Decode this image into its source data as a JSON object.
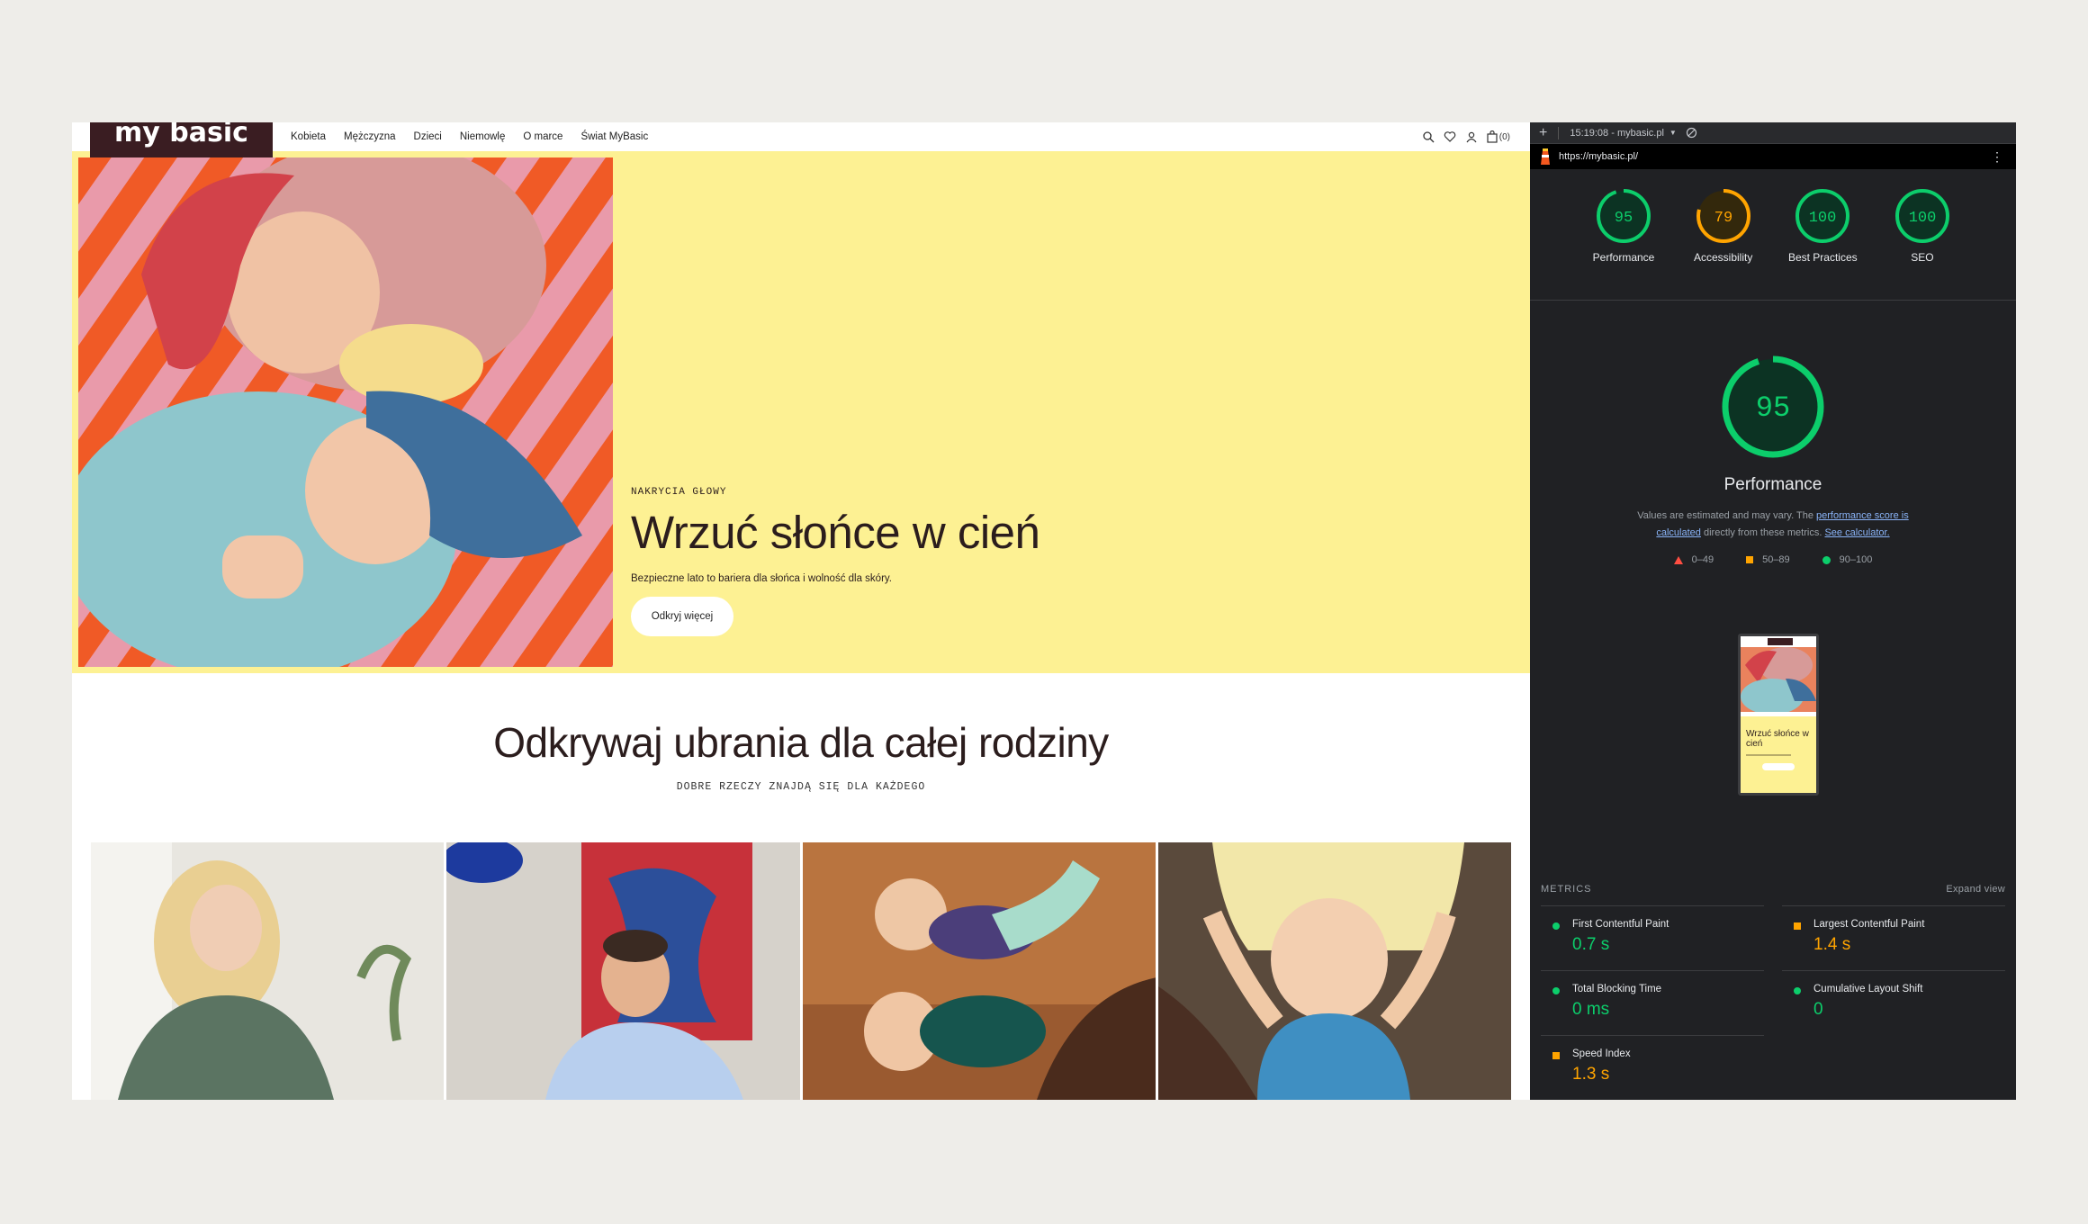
{
  "site": {
    "logo": "my basic",
    "nav": [
      "Kobieta",
      "Mężczyzna",
      "Dzieci",
      "Niemowlę",
      "O marce",
      "Świat MyBasic"
    ],
    "cart_count": "(0)",
    "hero": {
      "kicker": "NAKRYCIA GŁOWY",
      "headline": "Wrzuć słońce w cień",
      "subtext": "Bezpieczne lato to bariera dla słońca i wolność dla skóry.",
      "cta": "Odkryj więcej"
    },
    "section": {
      "title": "Odkrywaj ubrania dla całej rodziny",
      "subtitle": "DOBRE RZECZY ZNAJDĄ SIĘ DLA KAŻDEGO"
    }
  },
  "lighthouse": {
    "time_label": "15:19:08 - mybasic.pl",
    "url": "https://mybasic.pl/",
    "gauges": [
      {
        "score": 95,
        "label": "Performance",
        "status": "green"
      },
      {
        "score": 79,
        "label": "Accessibility",
        "status": "orange"
      },
      {
        "score": 100,
        "label": "Best Practices",
        "status": "green"
      },
      {
        "score": 100,
        "label": "SEO",
        "status": "green"
      }
    ],
    "main_score": 95,
    "main_label": "Performance",
    "desc_pre": "Values are estimated and may vary. The ",
    "desc_link1": "performance score is calculated",
    "desc_mid": " directly from these metrics. ",
    "desc_link2": "See calculator.",
    "legend": [
      "0–49",
      "50–89",
      "90–100"
    ],
    "thumb_headline": "Wrzuć słońce w cień",
    "metrics_heading": "METRICS",
    "expand": "Expand view",
    "metrics": [
      {
        "name": "First Contentful Paint",
        "value": "0.7 s",
        "status": "green"
      },
      {
        "name": "Largest Contentful Paint",
        "value": "1.4 s",
        "status": "orange"
      },
      {
        "name": "Total Blocking Time",
        "value": "0 ms",
        "status": "green"
      },
      {
        "name": "Cumulative Layout Shift",
        "value": "0",
        "status": "green"
      },
      {
        "name": "Speed Index",
        "value": "1.3 s",
        "status": "orange"
      }
    ],
    "colors": {
      "green": "#0cce6b",
      "orange": "#ffa400",
      "red": "#ff4e42"
    }
  }
}
